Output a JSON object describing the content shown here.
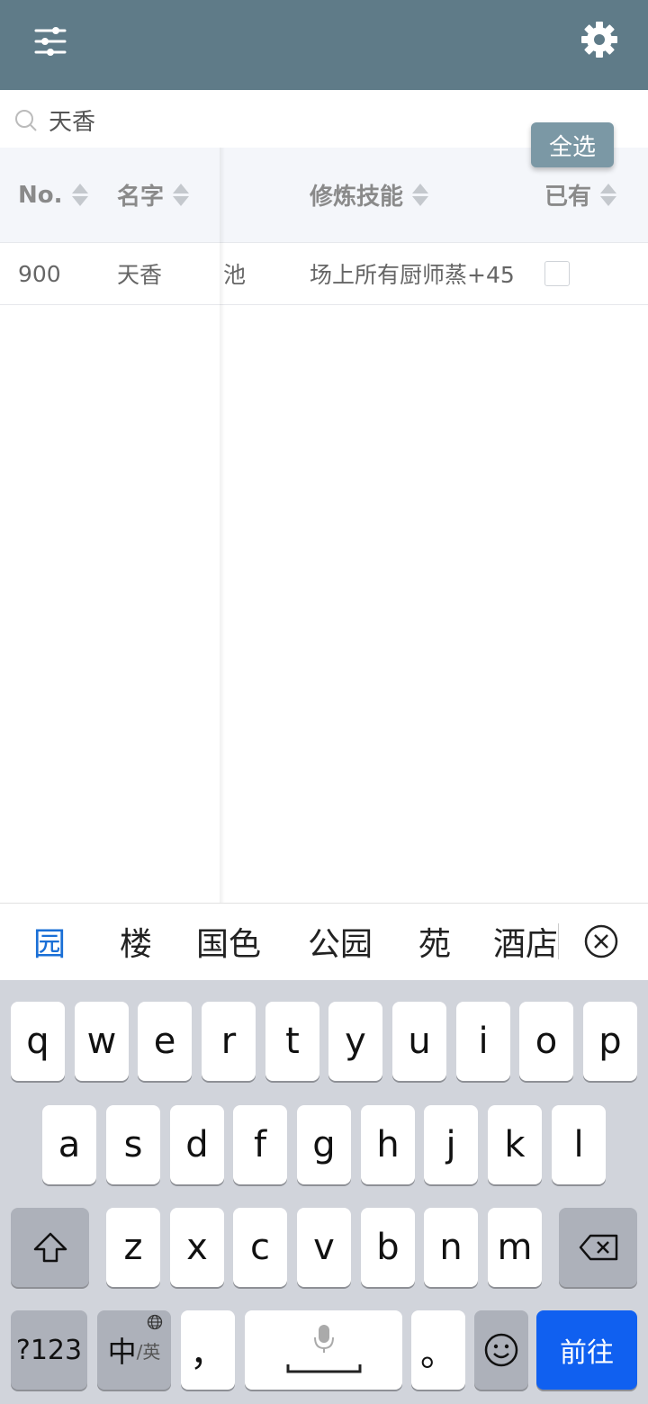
{
  "search": {
    "value": "天香",
    "select_all": "全选"
  },
  "table": {
    "headers": {
      "no": "No.",
      "name": "名字",
      "skill": "修炼技能",
      "owned": "已有"
    },
    "rows": [
      {
        "no": "900",
        "name": "天香",
        "partial": "池",
        "skill": "场上所有厨师蒸+45",
        "owned": false
      }
    ]
  },
  "ime": {
    "candidates": [
      "园",
      "楼",
      "国色",
      "公园",
      "苑",
      "酒店"
    ]
  },
  "keyboard": {
    "row1": [
      "q",
      "w",
      "e",
      "r",
      "t",
      "y",
      "u",
      "i",
      "o",
      "p"
    ],
    "row2": [
      "a",
      "s",
      "d",
      "f",
      "g",
      "h",
      "j",
      "k",
      "l"
    ],
    "row3": [
      "z",
      "x",
      "c",
      "v",
      "b",
      "n",
      "m"
    ],
    "num_key": "?123",
    "lang_main": "中",
    "lang_sub": "/英",
    "comma": "，",
    "period": "。",
    "go_key": "前往"
  },
  "icons": {
    "filter": "sliders-icon",
    "settings": "gear-icon",
    "search": "search-icon",
    "close": "close-circle-icon",
    "shift": "shift-icon",
    "backspace": "backspace-icon",
    "mic": "microphone-icon",
    "emoji": "emoji-icon",
    "globe": "globe-icon"
  },
  "colors": {
    "header": "#5f7b88",
    "select_all": "#7b98a5",
    "go_key": "#1060f0",
    "candidate_active": "#1a6fd6"
  }
}
